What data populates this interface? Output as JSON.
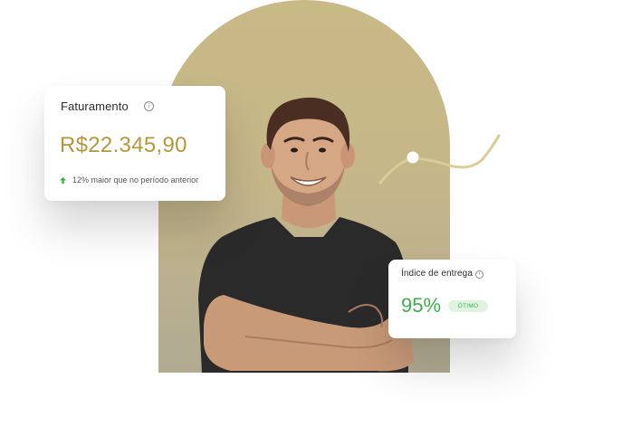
{
  "revenue_card": {
    "title": "Faturamento",
    "info_icon": "info-icon",
    "value": "R$22.345,90",
    "growth_icon": "arrow-up-icon",
    "growth_text": "12% maior que no período anterior"
  },
  "delivery_card": {
    "title": "Índice de entrega",
    "info_icon": "info-icon",
    "value": "95%",
    "status": "ÓTIMO"
  },
  "colors": {
    "gold": "#b7963b",
    "green": "#3cb04c",
    "badge_bg": "#dff3e0",
    "arch": "#c9b985"
  }
}
